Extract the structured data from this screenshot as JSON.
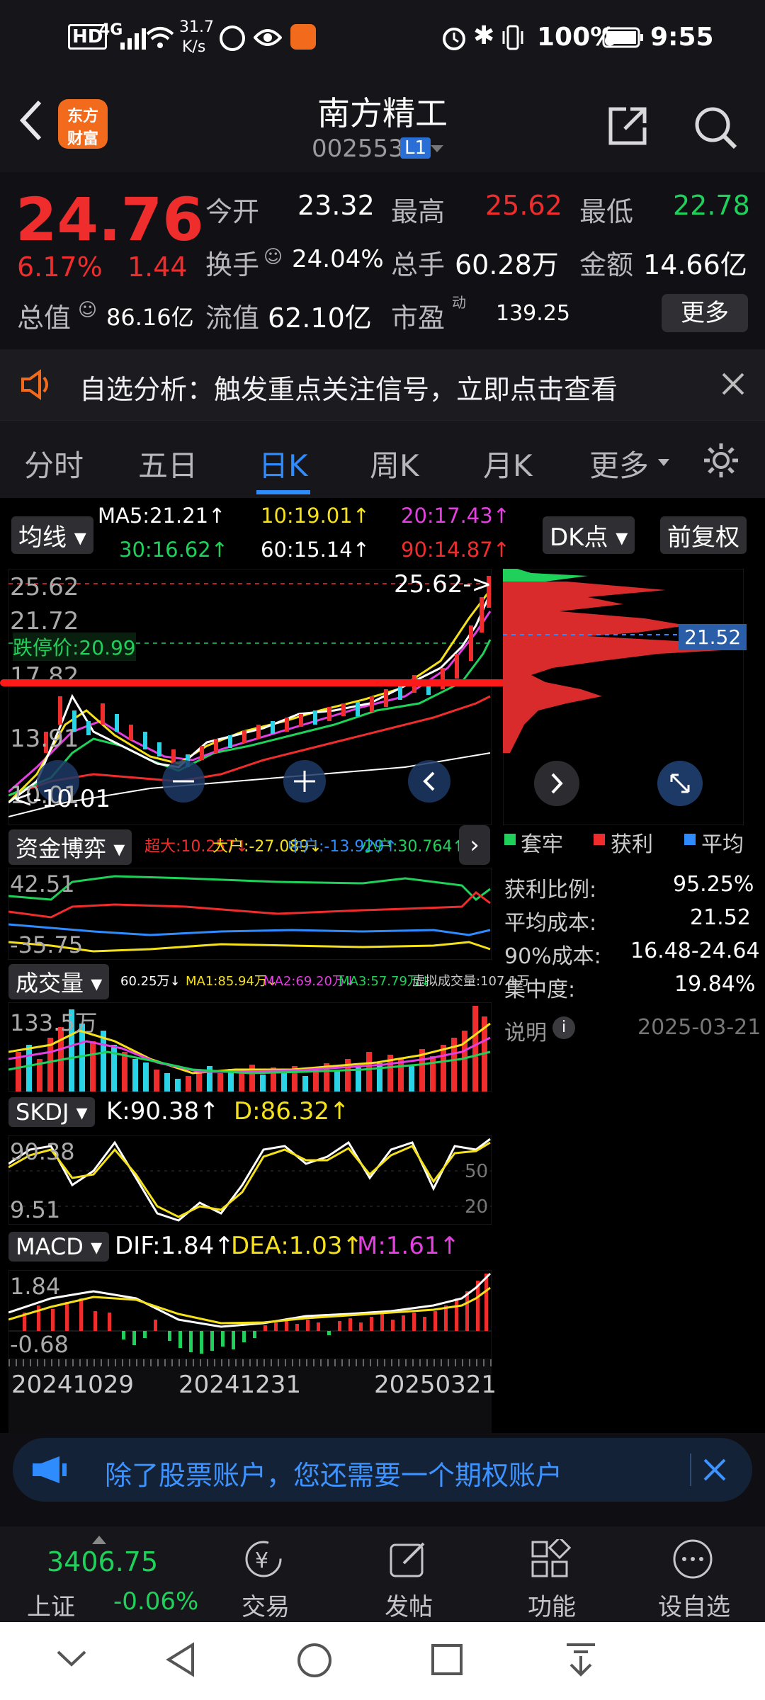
{
  "status_bar": {
    "network": "4G",
    "speed": "31.7",
    "speed_unit": "K/s",
    "battery": "100%",
    "time": "9:55"
  },
  "header": {
    "logo_line1": "东方",
    "logo_line2": "财富",
    "stock_name": "南方精工",
    "stock_code": "002553",
    "level_badge": "L1"
  },
  "quote": {
    "price": "24.76",
    "change_pct": "6.17%",
    "change_amt": "1.44",
    "open_label": "今开",
    "open": "23.32",
    "high_label": "最高",
    "high": "25.62",
    "low_label": "最低",
    "low": "22.78",
    "turnover_label": "换手",
    "turnover": "24.04%",
    "volume_label": "总手",
    "volume": "60.28万",
    "amount_label": "金额",
    "amount": "14.66亿",
    "mktcap_label": "总值",
    "mktcap": "86.16亿",
    "float_label": "流值",
    "float_value": "62.10亿",
    "pe_label": "市盈",
    "pe_sup": "动",
    "pe": "139.25",
    "more": "更多"
  },
  "notice": {
    "text": "自选分析：触发重点关注信号，立即点击查看"
  },
  "tabs": [
    "分时",
    "五日",
    "日K",
    "周K",
    "月K",
    "更多"
  ],
  "active_tab": 2,
  "kline": {
    "indicator_btn": "均线",
    "ma": [
      {
        "label": "MA5:21.21↑",
        "color": "#ffffff"
      },
      {
        "label": "10:19.01↑",
        "color": "#f5e11b"
      },
      {
        "label": "20:17.43↑",
        "color": "#e43fe0"
      },
      {
        "label": "30:16.62↑",
        "color": "#1fd15a"
      },
      {
        "label": "60:15.14↑",
        "color": "#ffffff"
      },
      {
        "label": "90:14.87↑",
        "color": "#ef2d2d"
      }
    ],
    "dk_btn": "DK点",
    "fq_btn": "前复权",
    "y_labels": [
      "25.62",
      "21.72",
      "17.82",
      "13.91",
      "10.01"
    ],
    "high_marker": "25.62->",
    "low_marker": "<-10.01",
    "limit_down": "跌停价:20.99"
  },
  "chip": {
    "avg_label": "21.52",
    "legend": [
      "套牢",
      "获利",
      "平均"
    ],
    "legend_colors": [
      "#1fd15a",
      "#ef2d2d",
      "#2f8cff"
    ],
    "rows": [
      {
        "k": "获利比例:",
        "v": "95.25%"
      },
      {
        "k": "平均成本:",
        "v": "21.52"
      },
      {
        "k": "90%成本:",
        "v": "16.48-24.64"
      },
      {
        "k": "集中度:",
        "v": "19.84%"
      }
    ],
    "note": "说明",
    "date": "2025-03-21"
  },
  "fund": {
    "title": "资金博弈",
    "super": "超大:10.257↓",
    "big": "大户:-27.089↓",
    "mid": "中户:-13.929↑",
    "small": "小户:30.764↑",
    "y": [
      "42.51",
      "-35.75"
    ]
  },
  "volume": {
    "title": "成交量",
    "vol": "60.25万↓",
    "ma1": "MA1:85.94万↓",
    "ma2": "MA2:69.20万↓",
    "ma3": "MA3:57.79万↓",
    "virtual": "虚拟成交量:107.1万",
    "y": "133.5万"
  },
  "skdj": {
    "title": "SKDJ",
    "k": "K:90.38↑",
    "d": "D:86.32↑",
    "y_top": "90.38",
    "y_bot": "9.51",
    "r1": "50",
    "r2": "20"
  },
  "macd": {
    "title": "MACD",
    "dif": "DIF:1.84↑",
    "dea": "DEA:1.03↑",
    "m": "M:1.61↑",
    "y_top": "1.84",
    "y_bot": "-0.68"
  },
  "dates": [
    "20241029",
    "20241231",
    "20250321"
  ],
  "banner": {
    "text": "除了股票账户，您还需要一个期权账户"
  },
  "bottom_nav": {
    "index_value": "3406.75",
    "index_name": "上证",
    "index_change": "-0.06%",
    "items": [
      "交易",
      "发帖",
      "功能",
      "设自选"
    ]
  }
}
